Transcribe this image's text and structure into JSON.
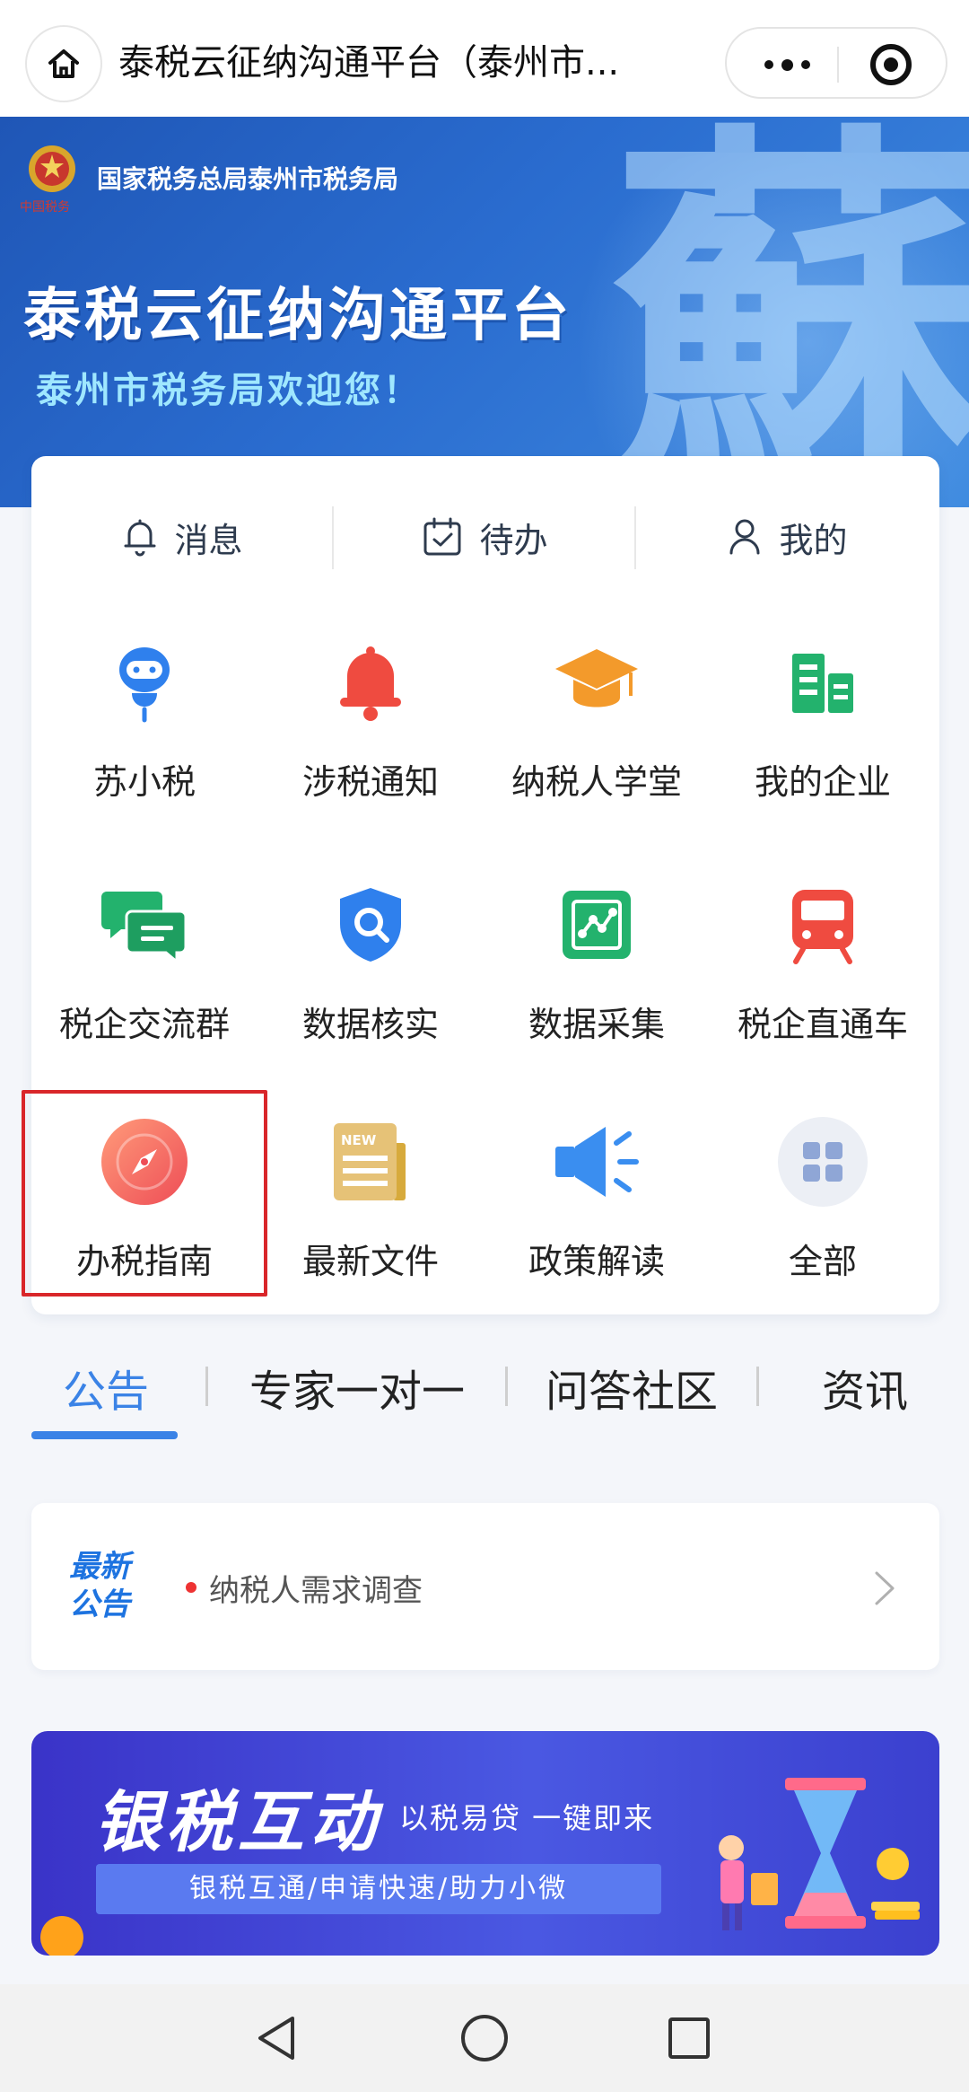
{
  "topbar": {
    "title": "泰税云征纳沟通平台（泰州市..."
  },
  "banner": {
    "emblem_caption": "中国税务",
    "bureau": "国家税务总局泰州市税务局",
    "platform_title": "泰税云征纳沟通平台",
    "welcome": "泰州市税务局欢迎您！",
    "calligraphy": "蘇"
  },
  "quick_bar": [
    {
      "label": "消息",
      "icon": "bell-outline-icon"
    },
    {
      "label": "待办",
      "icon": "calendar-check-icon"
    },
    {
      "label": "我的",
      "icon": "user-outline-icon"
    }
  ],
  "grid": [
    {
      "label": "苏小税",
      "icon": "robot-assistant-icon",
      "color": "#2f80ed"
    },
    {
      "label": "涉税通知",
      "icon": "bell-icon",
      "color": "#ef4b40"
    },
    {
      "label": "纳税人学堂",
      "icon": "graduation-cap-icon",
      "color": "#f39a2b"
    },
    {
      "label": "我的企业",
      "icon": "buildings-icon",
      "color": "#23b26d"
    },
    {
      "label": "税企交流群",
      "icon": "chat-bubbles-icon",
      "color": "#23b26d"
    },
    {
      "label": "数据核实",
      "icon": "shield-search-icon",
      "color": "#2f80ed"
    },
    {
      "label": "数据采集",
      "icon": "data-collect-icon",
      "color": "#23b26d"
    },
    {
      "label": "税企直通车",
      "icon": "train-icon",
      "color": "#ef4b40"
    },
    {
      "label": "办税指南",
      "icon": "compass-icon",
      "color": "#f26d5b"
    },
    {
      "label": "最新文件",
      "icon": "newspaper-icon",
      "color": "#e0b85a"
    },
    {
      "label": "政策解读",
      "icon": "megaphone-icon",
      "color": "#3a8ef0"
    },
    {
      "label": "全部",
      "icon": "grid-all-icon",
      "color": "#8fa6d6"
    }
  ],
  "tabs": [
    {
      "label": "公告",
      "active": true
    },
    {
      "label": "专家一对一",
      "active": false
    },
    {
      "label": "问答社区",
      "active": false
    },
    {
      "label": "资讯",
      "active": false
    }
  ],
  "notice": {
    "tag_line1": "最新",
    "tag_line2": "公告",
    "text": "纳税人需求调查"
  },
  "ad": {
    "title": "银税互动",
    "subtitle": "以税易贷  一键即来",
    "strip": "银税互通/申请快速/助力小微"
  },
  "accent_color": "#3b83e6",
  "highlight_color": "#d9262a"
}
